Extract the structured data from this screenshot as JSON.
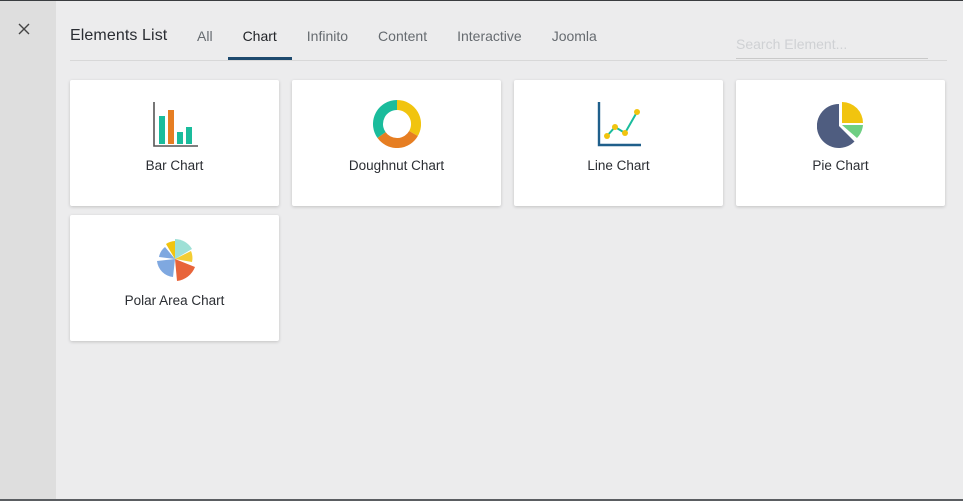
{
  "header": {
    "title": "Elements List",
    "tabs": [
      {
        "label": "All",
        "active": false
      },
      {
        "label": "Chart",
        "active": true
      },
      {
        "label": "Infinito",
        "active": false
      },
      {
        "label": "Content",
        "active": false
      },
      {
        "label": "Interactive",
        "active": false
      },
      {
        "label": "Joomla",
        "active": false
      }
    ],
    "search_placeholder": "Search Element...",
    "search_value": ""
  },
  "close_icon": "close-icon",
  "elements": [
    {
      "label": "Bar Chart",
      "icon": "bar-chart-icon"
    },
    {
      "label": "Doughnut Chart",
      "icon": "doughnut-chart-icon"
    },
    {
      "label": "Line Chart",
      "icon": "line-chart-icon"
    },
    {
      "label": "Pie Chart",
      "icon": "pie-chart-icon"
    },
    {
      "label": "Polar Area Chart",
      "icon": "polar-area-chart-icon"
    }
  ],
  "colors": {
    "active_tab_underline": "#1e4a6e",
    "teal": "#1abc9c",
    "orange": "#e67e22",
    "yellow": "#f1c40f",
    "navy": "#1f5f8b",
    "slate": "#4f5d80",
    "green": "#6fcf83",
    "red_orange": "#e8643a",
    "light_blue": "#7fa8e0",
    "mint": "#9ee0d6"
  }
}
